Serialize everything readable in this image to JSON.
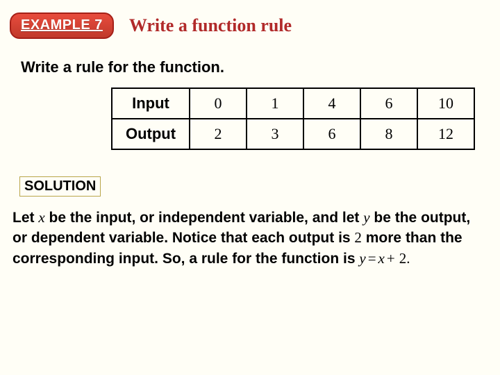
{
  "header": {
    "badge": "EXAMPLE 7",
    "title": "Write a function rule"
  },
  "instruction": "Write a rule for the function.",
  "table": {
    "rows": [
      {
        "label": "Input",
        "values": [
          "0",
          "1",
          "4",
          "6",
          "10"
        ]
      },
      {
        "label": "Output",
        "values": [
          "2",
          "3",
          "6",
          "8",
          "12"
        ]
      }
    ]
  },
  "solution": {
    "label": "SOLUTION",
    "text": {
      "p1a": "Let ",
      "var_x": "x",
      "p1b": " be the input, or independent variable, and let ",
      "var_y": "y",
      "p1c": " be the output, or dependent variable. Notice that each output is ",
      "num_two": "2",
      "p1d": " more than the corresponding input. So, a rule for the function is ",
      "eqn_y": "y",
      "eqn_eq": "=",
      "eqn_x": "x",
      "eqn_plus": "+",
      "eqn_two": "2.",
      "p1e": ""
    }
  }
}
